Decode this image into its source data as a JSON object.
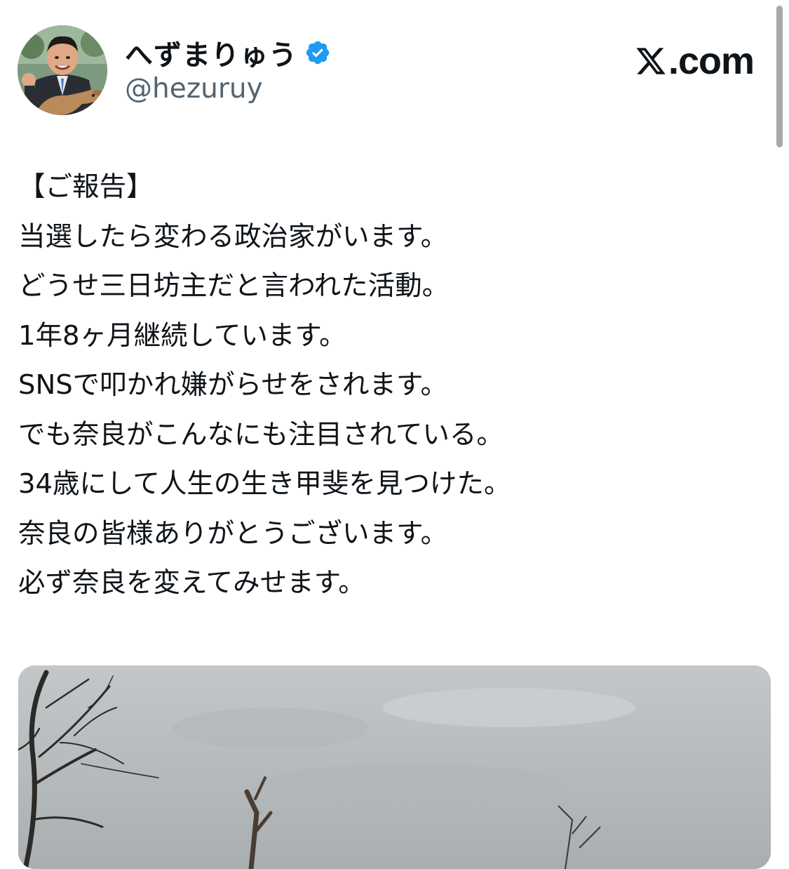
{
  "site_logo": {
    "icon": "x-logo-icon",
    "suffix": ".com"
  },
  "author": {
    "display_name": "へずまりゅう",
    "handle": "@hezuruy",
    "verified": true,
    "verified_color": "#1d9bf0"
  },
  "tweet": {
    "lines": [
      "【ご報告】",
      "当選したら変わる政治家がいます。",
      "どうせ三日坊主だと言われた活動。",
      "1年8ヶ月継続しています。",
      "SNSで叩かれ嫌がらせをされます。",
      "でも奈良がこんなにも注目されている。",
      "34歳にして人生の生き甲斐を見つけた。",
      "奈良の皆様ありがとうございます。",
      "必ず奈良を変えてみせます。"
    ]
  },
  "colors": {
    "text": "#0f1419",
    "secondary_text": "#536471",
    "background": "#ffffff"
  }
}
